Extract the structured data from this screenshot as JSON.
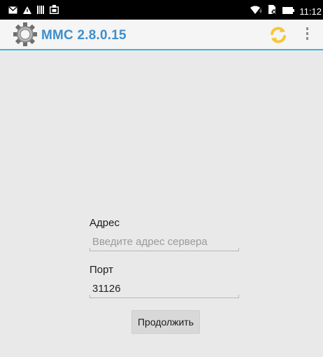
{
  "status_bar": {
    "time": "11:12",
    "left_icons": [
      "mail-icon",
      "warning-icon",
      "barcode-icon",
      "screenshot-icon"
    ],
    "right_icons": [
      "wifi-icon",
      "no-sim-icon",
      "battery-icon"
    ]
  },
  "action_bar": {
    "title": "MMC 2.8.0.15",
    "app_icon": "gear-icon",
    "actions": [
      "refresh-icon",
      "overflow-menu-icon"
    ],
    "accent_color": "#33b5e5",
    "title_color": "#3d8fce"
  },
  "form": {
    "address_label": "Адрес",
    "address_placeholder": "Введите адрес сервера",
    "address_value": "",
    "port_label": "Порт",
    "port_value": "31126",
    "continue_label": "Продолжить"
  }
}
